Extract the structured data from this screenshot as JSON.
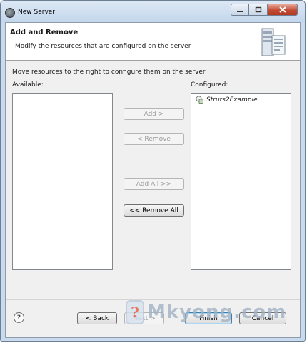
{
  "window": {
    "title": "New Server"
  },
  "header": {
    "title": "Add and Remove",
    "description": "Modify the resources that are configured on the server",
    "icon": "server-icon"
  },
  "instructions": "Move resources to the right to configure them on the server",
  "available": {
    "label": "Available:",
    "items": []
  },
  "configured": {
    "label": "Configured:",
    "items": [
      {
        "label": "Struts2Example",
        "icon": "project-icon"
      }
    ]
  },
  "buttons": {
    "add": "Add >",
    "remove": "< Remove",
    "add_all": "Add All >>",
    "remove_all": "<< Remove All"
  },
  "footer": {
    "help": "?",
    "back": "< Back",
    "next": "Next >",
    "finish": "Finish",
    "cancel": "Cancel"
  },
  "watermark": {
    "badge": "?",
    "text": "Mkyong.com"
  },
  "colors": {
    "window_frame": "#c9d9ee",
    "close_button": "#c24b33",
    "dialog_bg": "#f0f0f0"
  }
}
